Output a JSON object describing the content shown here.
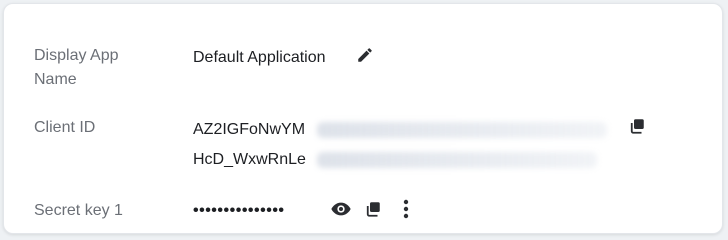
{
  "rows": {
    "display_app_name": {
      "label": "Display App Name",
      "value": "Default Application"
    },
    "client_id": {
      "label": "Client ID",
      "line1_visible": "AZ2IGFoNwYM",
      "line2_visible": "HcD_WxwRnLe"
    },
    "secret_key": {
      "label": "Secret key 1",
      "masked_value": "•••••••••••••••"
    }
  },
  "icons": {
    "edit": "pencil-icon",
    "copy": "copy-icon",
    "show": "eye-icon",
    "more": "more-vertical-icon"
  },
  "colors": {
    "label": "#6b6f76",
    "text": "#1d1f23",
    "icon": "#2b2d31"
  }
}
